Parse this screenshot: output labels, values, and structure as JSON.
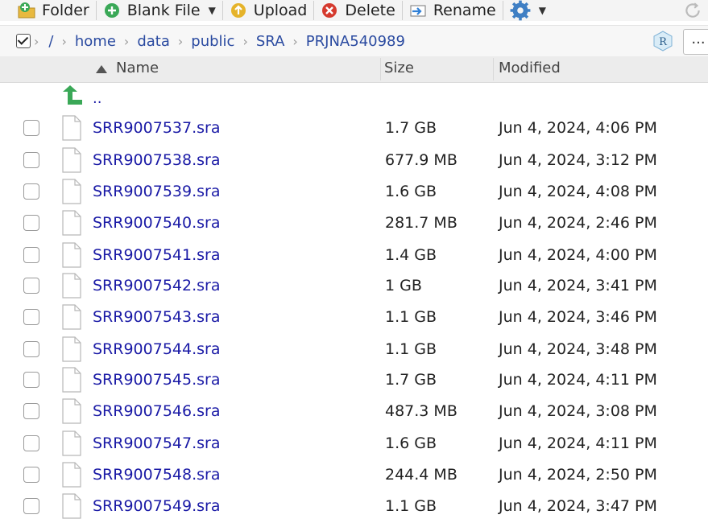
{
  "toolbar": {
    "new_folder": "Folder",
    "blank_file": "Blank File",
    "upload": "Upload",
    "delete": "Delete",
    "rename": "Rename"
  },
  "breadcrumb": {
    "root": "/",
    "parts": [
      "home",
      "data",
      "public",
      "SRA",
      "PRJNA540989"
    ]
  },
  "more_button": "...",
  "columns": {
    "name": "Name",
    "size": "Size",
    "modified": "Modified"
  },
  "parent_dir": "..",
  "files": [
    {
      "name": "SRR9007537.sra",
      "size": "1.7 GB",
      "modified": "Jun 4, 2024, 4:06 PM"
    },
    {
      "name": "SRR9007538.sra",
      "size": "677.9 MB",
      "modified": "Jun 4, 2024, 3:12 PM"
    },
    {
      "name": "SRR9007539.sra",
      "size": "1.6 GB",
      "modified": "Jun 4, 2024, 4:08 PM"
    },
    {
      "name": "SRR9007540.sra",
      "size": "281.7 MB",
      "modified": "Jun 4, 2024, 2:46 PM"
    },
    {
      "name": "SRR9007541.sra",
      "size": "1.4 GB",
      "modified": "Jun 4, 2024, 4:00 PM"
    },
    {
      "name": "SRR9007542.sra",
      "size": "1 GB",
      "modified": "Jun 4, 2024, 3:41 PM"
    },
    {
      "name": "SRR9007543.sra",
      "size": "1.1 GB",
      "modified": "Jun 4, 2024, 3:46 PM"
    },
    {
      "name": "SRR9007544.sra",
      "size": "1.1 GB",
      "modified": "Jun 4, 2024, 3:48 PM"
    },
    {
      "name": "SRR9007545.sra",
      "size": "1.7 GB",
      "modified": "Jun 4, 2024, 4:11 PM"
    },
    {
      "name": "SRR9007546.sra",
      "size": "487.3 MB",
      "modified": "Jun 4, 2024, 3:08 PM"
    },
    {
      "name": "SRR9007547.sra",
      "size": "1.6 GB",
      "modified": "Jun 4, 2024, 4:11 PM"
    },
    {
      "name": "SRR9007548.sra",
      "size": "244.4 MB",
      "modified": "Jun 4, 2024, 2:50 PM"
    },
    {
      "name": "SRR9007549.sra",
      "size": "1.1 GB",
      "modified": "Jun 4, 2024, 3:47 PM"
    }
  ],
  "icons": {
    "new_folder": "folder-add-icon",
    "blank_file": "plus-circle-icon",
    "upload": "upload-icon",
    "delete": "delete-icon",
    "rename": "rename-icon",
    "more": "gear-icon",
    "refresh": "refresh-icon",
    "project": "r-project-icon",
    "parent": "up-arrow-icon",
    "file": "file-icon"
  },
  "colors": {
    "link": "#1a1aa6",
    "breadcrumb": "#2a4aa0",
    "parent_arrow": "#3aa857"
  }
}
